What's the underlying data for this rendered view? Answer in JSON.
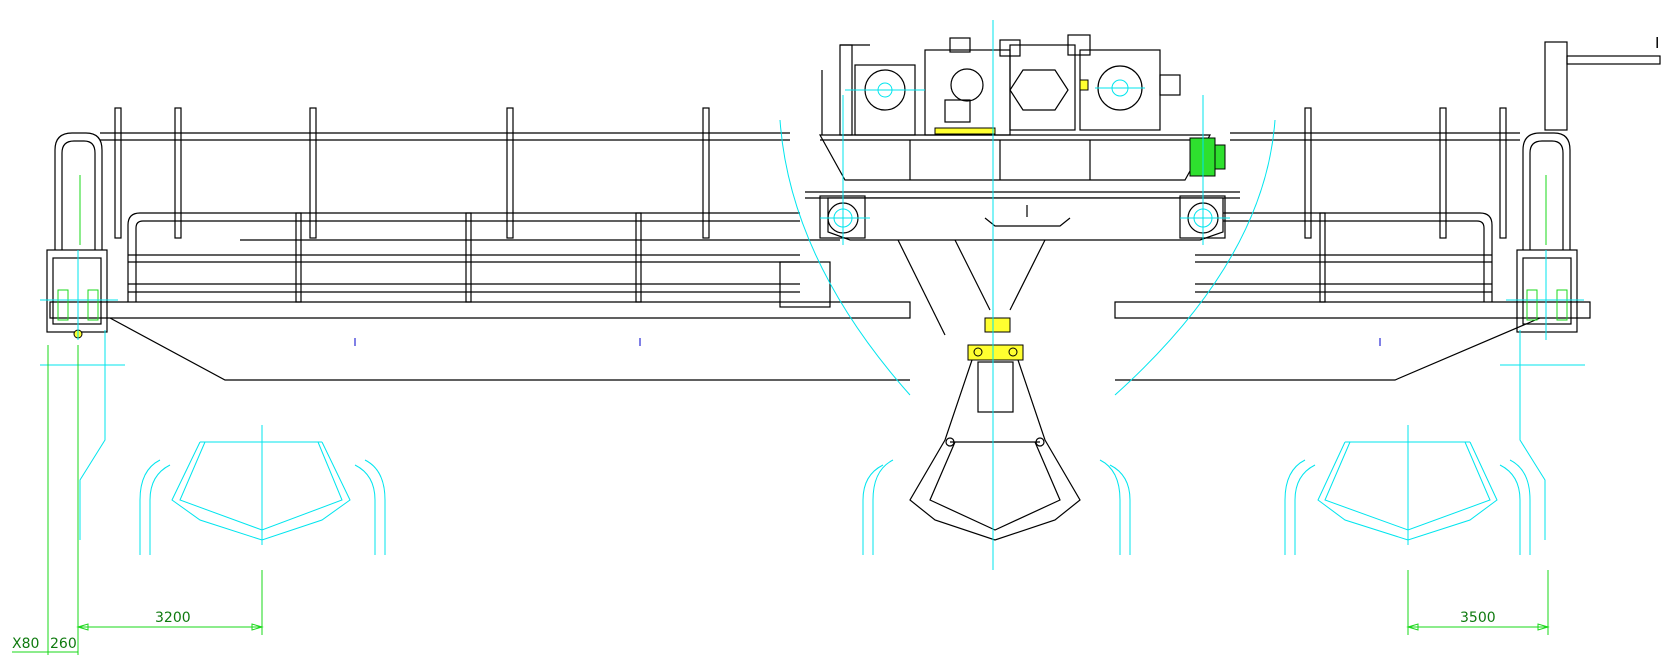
{
  "drawing": {
    "colors": {
      "structure": "#000000",
      "centerlines": "#00e5ee",
      "dimensions": "#18d818",
      "dimension_text": "#0f7a0f",
      "highlight": "#ffff30",
      "markers": "#0000cc"
    },
    "dimensions": {
      "left_edge": "X80",
      "left_offset": "260",
      "left_span": "3200",
      "right_span": "3500"
    },
    "corner_label": "I"
  }
}
